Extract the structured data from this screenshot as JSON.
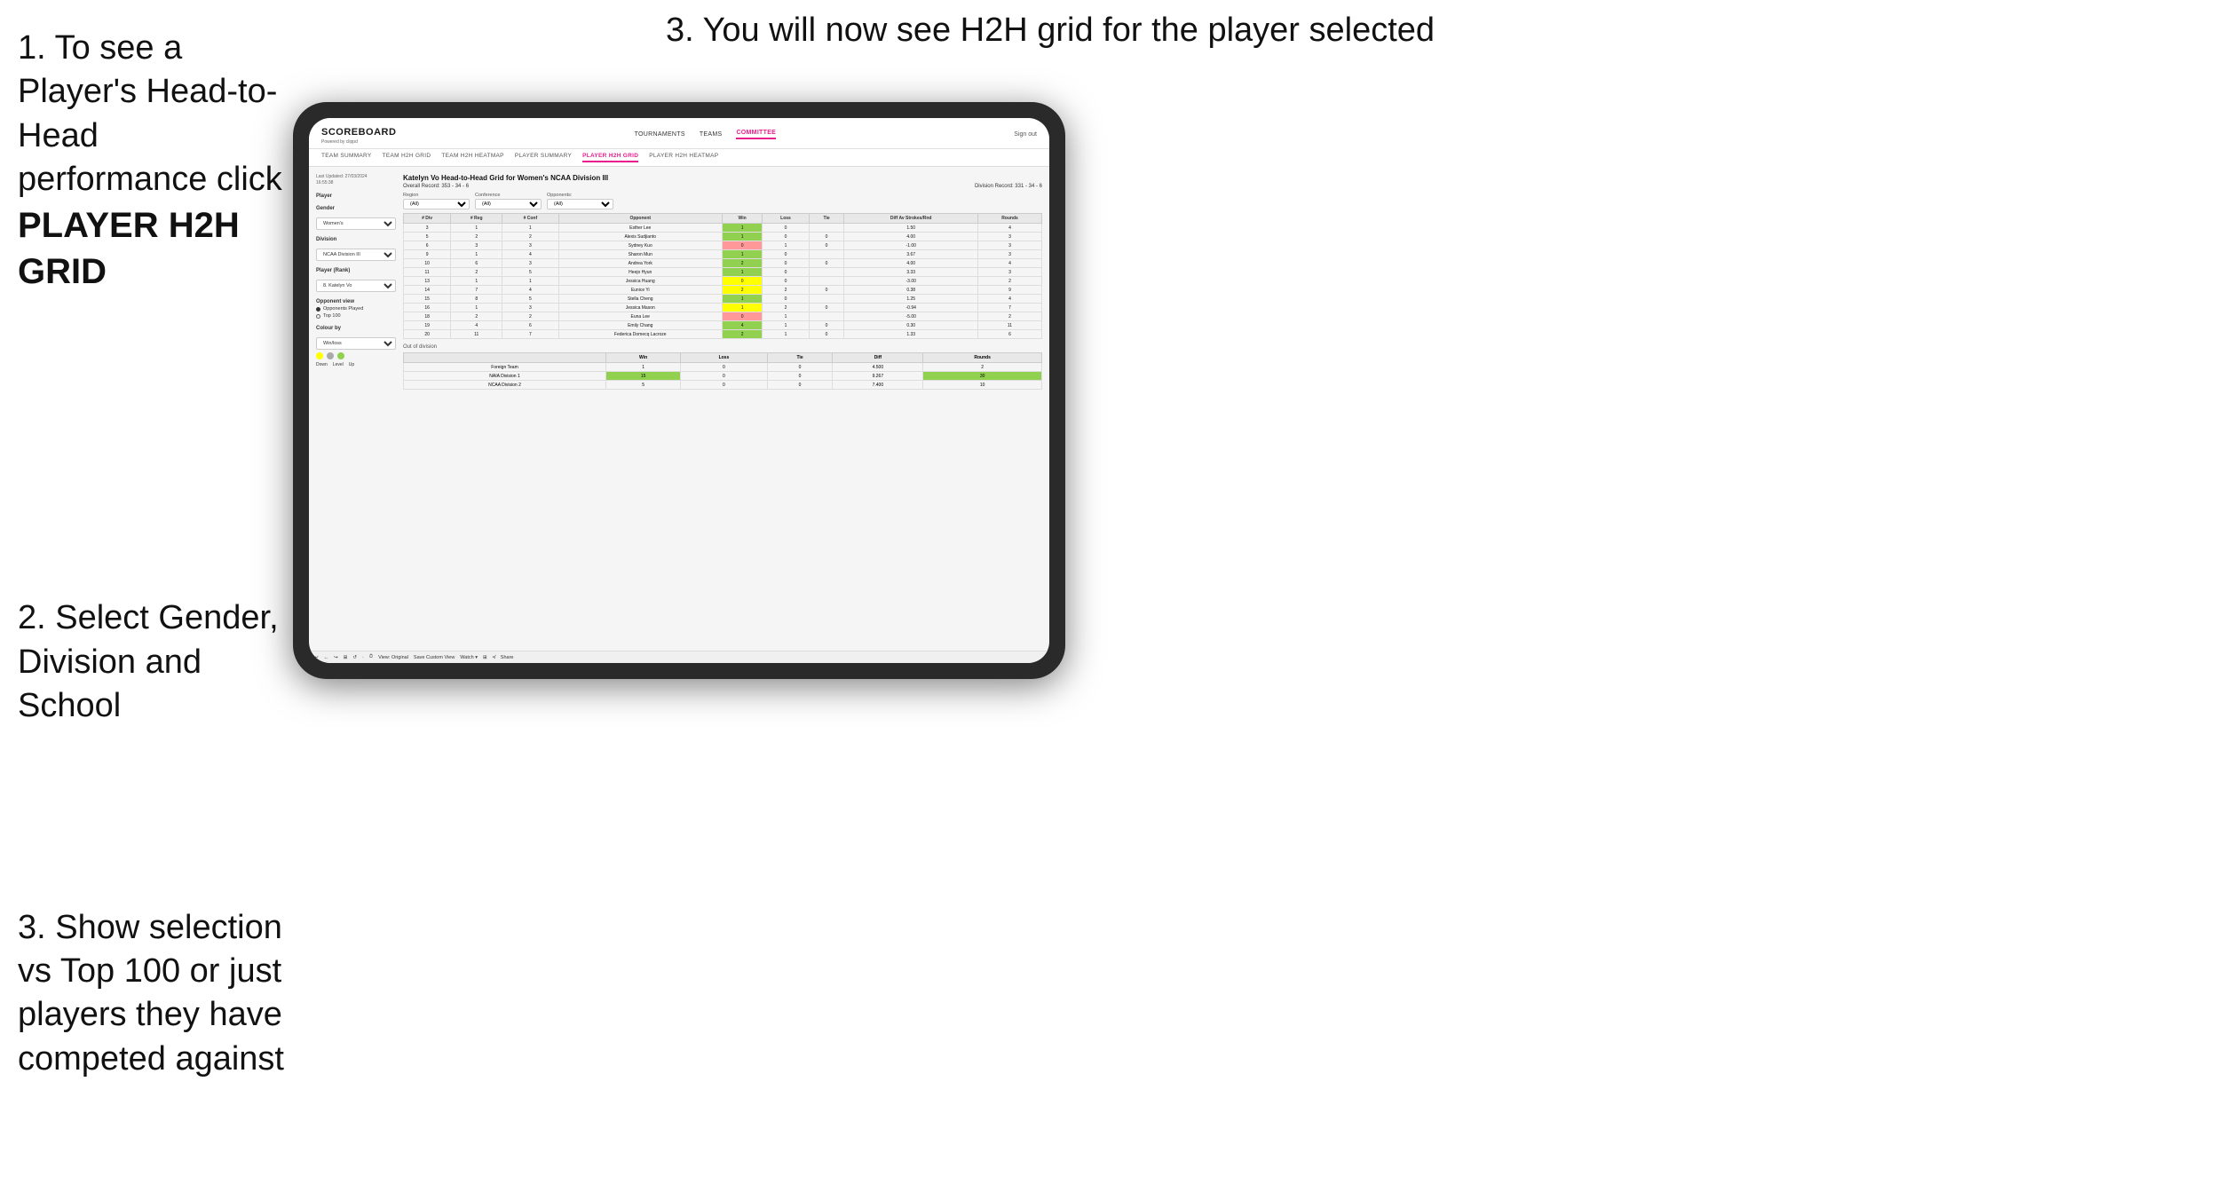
{
  "instructions": {
    "step1_text": "1. To see a Player's Head-to-Head performance click",
    "step1_bold": "PLAYER H2H GRID",
    "step2_text": "2. Select Gender, Division and School",
    "step3_left": "3. Show selection vs Top 100 or just players they have competed against",
    "step3_right": "3. You will now see H2H grid for the player selected"
  },
  "nav": {
    "logo": "SCOREBOARD",
    "logo_sub": "Powered by clippd",
    "links": [
      "TOURNAMENTS",
      "TEAMS",
      "COMMITTEE"
    ],
    "sign_out": "Sign out",
    "sub_links": [
      "TEAM SUMMARY",
      "TEAM H2H GRID",
      "TEAM H2H HEATMAP",
      "PLAYER SUMMARY",
      "PLAYER H2H GRID",
      "PLAYER H2H HEATMAP"
    ]
  },
  "left_panel": {
    "last_updated_label": "Last Updated: 27/03/2024",
    "last_updated_time": "16:55:38",
    "player_label": "Player",
    "gender_label": "Gender",
    "gender_value": "Women's",
    "division_label": "Division",
    "division_value": "NCAA Division III",
    "player_rank_label": "Player (Rank)",
    "player_rank_value": "8. Katelyn Vo",
    "opponent_view_label": "Opponent view",
    "radio1": "Opponents Played",
    "radio2": "Top 100",
    "colour_by_label": "Colour by",
    "colour_by_value": "Win/loss"
  },
  "grid": {
    "title": "Katelyn Vo Head-to-Head Grid for Women's NCAA Division III",
    "overall_record": "Overall Record: 353 - 34 - 6",
    "division_record": "Division Record: 331 - 34 - 6",
    "filter_opponents": "Opponents:",
    "filter_region": "Region",
    "filter_conference": "Conference",
    "filter_opponent": "Opponent",
    "filter_all": "(All)",
    "columns": [
      "# Div",
      "# Reg",
      "# Conf",
      "Opponent",
      "Win",
      "Loss",
      "Tie",
      "Diff Av Strokes/Rnd",
      "Rounds"
    ],
    "rows": [
      {
        "div": "3",
        "reg": "1",
        "conf": "1",
        "opponent": "Esther Lee",
        "win": "1",
        "loss": "0",
        "tie": "",
        "diff": "1.50",
        "rounds": "4",
        "win_color": "green"
      },
      {
        "div": "5",
        "reg": "2",
        "conf": "2",
        "opponent": "Alexis Sudjianto",
        "win": "1",
        "loss": "0",
        "tie": "0",
        "diff": "4.00",
        "rounds": "3",
        "win_color": "green"
      },
      {
        "div": "6",
        "reg": "3",
        "conf": "3",
        "opponent": "Sydney Kuo",
        "win": "0",
        "loss": "1",
        "tie": "0",
        "diff": "-1.00",
        "rounds": "3",
        "win_color": "red"
      },
      {
        "div": "9",
        "reg": "1",
        "conf": "4",
        "opponent": "Sharon Mun",
        "win": "1",
        "loss": "0",
        "tie": "",
        "diff": "3.67",
        "rounds": "3",
        "win_color": "green"
      },
      {
        "div": "10",
        "reg": "6",
        "conf": "3",
        "opponent": "Andrea York",
        "win": "2",
        "loss": "0",
        "tie": "0",
        "diff": "4.00",
        "rounds": "4",
        "win_color": "green"
      },
      {
        "div": "11",
        "reg": "2",
        "conf": "5",
        "opponent": "Heejo Hyun",
        "win": "1",
        "loss": "0",
        "tie": "",
        "diff": "3.33",
        "rounds": "3",
        "win_color": "green"
      },
      {
        "div": "13",
        "reg": "1",
        "conf": "1",
        "opponent": "Jessica Huang",
        "win": "0",
        "loss": "0",
        "tie": "",
        "diff": "-3.00",
        "rounds": "2",
        "win_color": "yellow"
      },
      {
        "div": "14",
        "reg": "7",
        "conf": "4",
        "opponent": "Eunice Yi",
        "win": "2",
        "loss": "2",
        "tie": "0",
        "diff": "0.38",
        "rounds": "9",
        "win_color": "yellow"
      },
      {
        "div": "15",
        "reg": "8",
        "conf": "5",
        "opponent": "Stella Cheng",
        "win": "1",
        "loss": "0",
        "tie": "",
        "diff": "1.25",
        "rounds": "4",
        "win_color": "green"
      },
      {
        "div": "16",
        "reg": "1",
        "conf": "3",
        "opponent": "Jessica Mason",
        "win": "1",
        "loss": "2",
        "tie": "0",
        "diff": "-0.94",
        "rounds": "7",
        "win_color": "yellow"
      },
      {
        "div": "18",
        "reg": "2",
        "conf": "2",
        "opponent": "Euna Lee",
        "win": "0",
        "loss": "1",
        "tie": "",
        "diff": "-5.00",
        "rounds": "2",
        "win_color": "red"
      },
      {
        "div": "19",
        "reg": "4",
        "conf": "6",
        "opponent": "Emily Chang",
        "win": "4",
        "loss": "1",
        "tie": "0",
        "diff": "0.30",
        "rounds": "11",
        "win_color": "green"
      },
      {
        "div": "20",
        "reg": "11",
        "conf": "7",
        "opponent": "Federica Domecq Lacroze",
        "win": "2",
        "loss": "1",
        "tie": "0",
        "diff": "1.33",
        "rounds": "6",
        "win_color": "green"
      }
    ],
    "out_of_division_title": "Out of division",
    "out_rows": [
      {
        "team": "Foreign Team",
        "win": "1",
        "loss": "0",
        "tie": "0",
        "diff": "4.500",
        "rounds": "2"
      },
      {
        "team": "NAIA Division 1",
        "win": "15",
        "loss": "0",
        "tie": "0",
        "diff": "9.267",
        "rounds": "30"
      },
      {
        "team": "NCAA Division 2",
        "win": "5",
        "loss": "0",
        "tie": "0",
        "diff": "7.400",
        "rounds": "10"
      }
    ]
  },
  "toolbar": {
    "items": [
      "↩",
      "←",
      "↪",
      "⊞",
      "↺",
      "·",
      "⏱",
      "View: Original",
      "Save Custom View",
      "Watch ▾",
      "⊞",
      "≮",
      "Share"
    ]
  }
}
